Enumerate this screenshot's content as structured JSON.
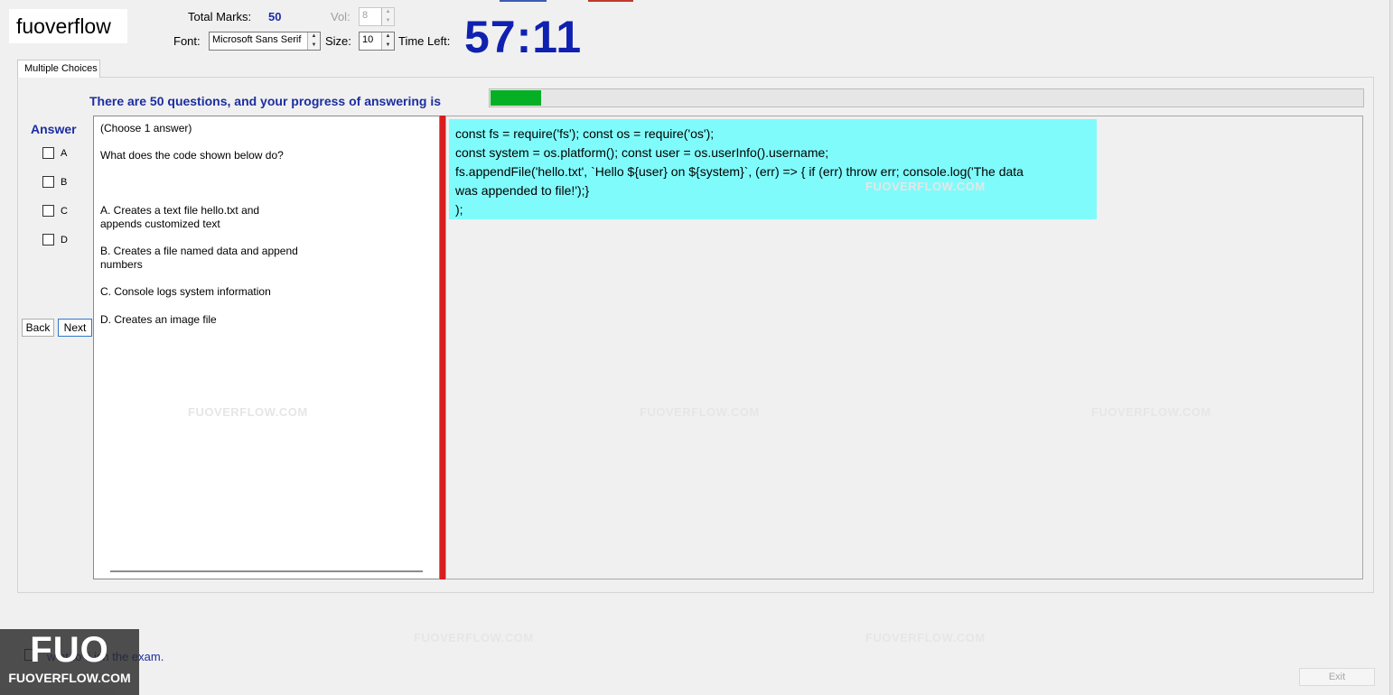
{
  "brand": "fuoverflow",
  "header": {
    "total_marks_label": "Total Marks:",
    "total_marks_value": "50",
    "vol_label": "Vol:",
    "vol_value": "8",
    "font_label": "Font:",
    "font_value": "Microsoft Sans Serif",
    "size_label": "Size:",
    "size_value": "10",
    "time_left_label": "Time Left:",
    "time_left_value": "57:11"
  },
  "tab_label": "Multiple Choices",
  "progress": {
    "text": "There are 50 questions, and your progress of answering is",
    "fraction": 0.058
  },
  "answer": {
    "title": "Answer",
    "options": [
      "A",
      "B",
      "C",
      "D"
    ]
  },
  "nav": {
    "back_label": "Back",
    "next_label": "Next"
  },
  "question": {
    "instruction": "(Choose 1 answer)",
    "prompt": "What does the code shown below do?",
    "choices": [
      {
        "line1": "A.  Creates a text file hello.txt and",
        "line2": "appends customized text"
      },
      {
        "line1": "B.  Creates a file named data and append",
        "line2": "numbers"
      },
      {
        "line1": "C.  Console logs system information",
        "line2": ""
      },
      {
        "line1": "D.  Creates an image file",
        "line2": ""
      }
    ]
  },
  "code_lines": [
    "const fs = require('fs'); const os = require('os');",
    "const system = os.platform(); const user = os.userInfo().username;",
    "fs.appendFile('hello.txt', `Hello ${user} on ${system}`, (err) => { if (err) throw err; console.log('The data",
    "was appended to file!');}",
    ");"
  ],
  "footer": {
    "finish_text_visible": "w   nt to  fi  ish the exam.",
    "exit_label": "Exit"
  },
  "watermark": {
    "site": "FUOVERFLOW.COM",
    "logo_big": "FUO",
    "logo_small": "FUOVERFLOW.COM"
  },
  "colors": {
    "accent_blue": "#1c2ea0",
    "timer_blue": "#1020b0",
    "progress_green": "#06b025",
    "code_bg": "#80fbfb",
    "splitter_red": "#d81e1e"
  }
}
